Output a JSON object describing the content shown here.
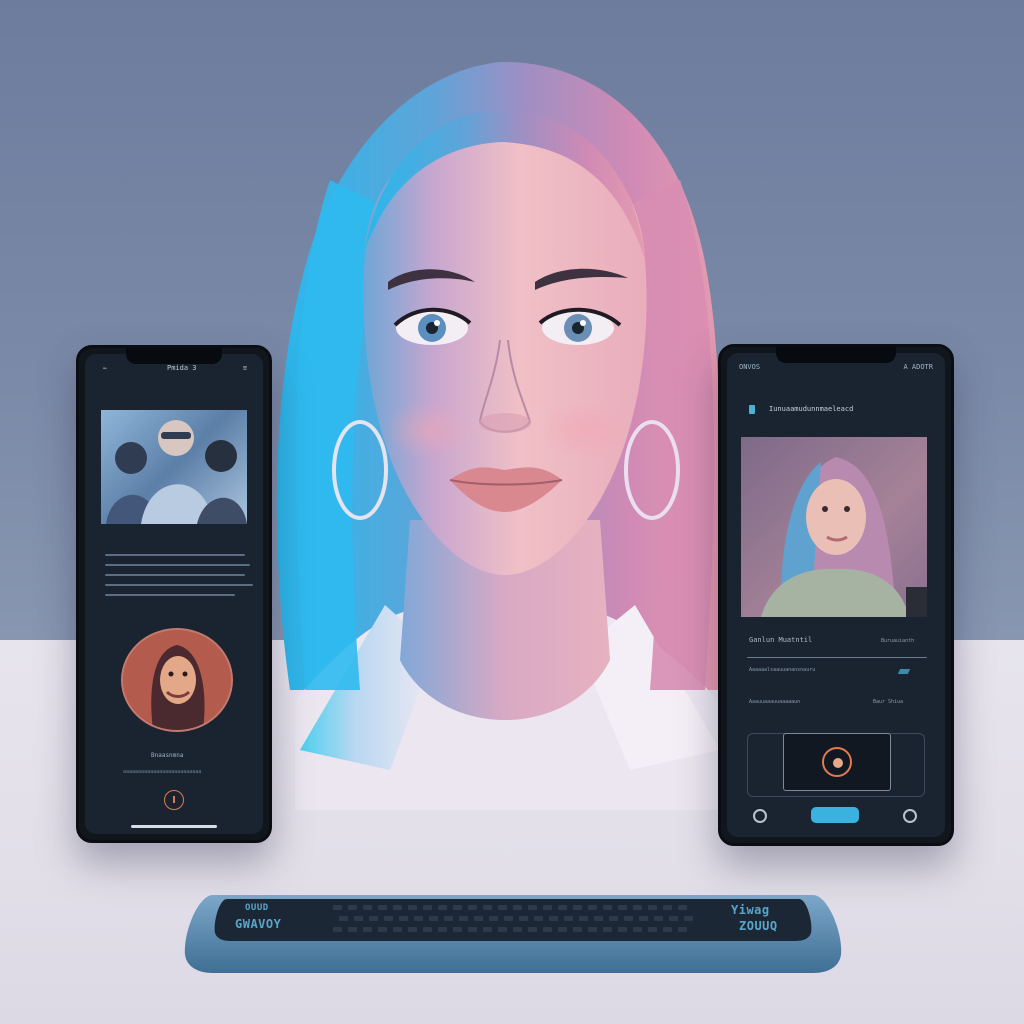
{
  "colors": {
    "wall_top": "#6f7fa0",
    "wall_bottom": "#8290ab",
    "desk": "#e4e0ea",
    "phone_body": "#11161d",
    "screen": "#1a2431",
    "accent_cyan": "#3ab2e0",
    "accent_orange": "#e07b50",
    "hair_blue": "#38b8e6",
    "hair_pink": "#d88fb0",
    "skin": "#e8b8c2"
  },
  "left_phone": {
    "header_title": "Pmida 3",
    "caption": "Bnaasnmna",
    "caption_sub": "aaaaaaaaaaaaaaaaaaaaaaaaaa",
    "record_icon": "record-icon"
  },
  "right_phone": {
    "status_left": "ONVOS",
    "status_right": "A ADOTR",
    "profile_title": "Iunuaamudunnmaeleacd",
    "row1_left": "Ganlun Muatntil",
    "row1_right": "Buruauianth",
    "row2_left": "Aaaaaalsaauuanansnauru",
    "row3_left": "Aaauuaaauuaaaaaun",
    "row3_right": "Baur Shiua",
    "camera_icon": "camera-icon",
    "bottom_left_icon": "chat-icon",
    "bottom_right_icon": "settings-icon"
  },
  "keyboard": {
    "left_label_top": "OUUD",
    "left_label_bottom": "GWAVOY",
    "right_label_top": "Yiwag",
    "right_label_bottom": "ZOUUQ"
  }
}
